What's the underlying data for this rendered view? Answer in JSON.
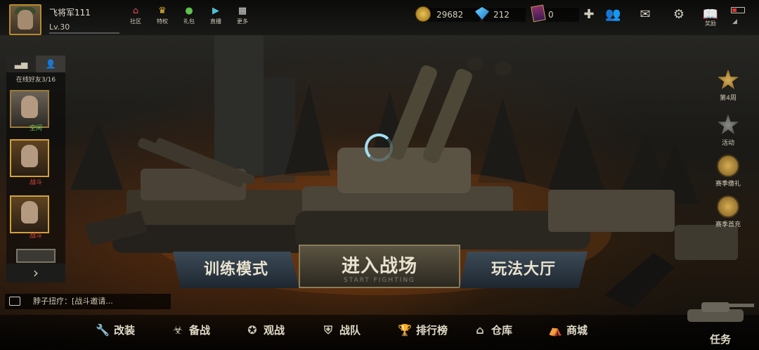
{
  "player": {
    "name": "飞将军111",
    "level": "Lv.30"
  },
  "top_nav": [
    {
      "icon": "home-icon",
      "label": "社区"
    },
    {
      "icon": "crown-icon",
      "label": "特权"
    },
    {
      "icon": "wechat-icon",
      "label": "礼包"
    },
    {
      "icon": "play-icon",
      "label": "直播"
    },
    {
      "icon": "grid-icon",
      "label": "更多"
    }
  ],
  "resources": {
    "gold": "29682",
    "diamonds": "212",
    "tickets": "0"
  },
  "top_right": {
    "reward_label": "奖励"
  },
  "friends_panel": {
    "online_text": "在线好友3/16",
    "friends": [
      {
        "tag": "空闲",
        "tag_color": "#6fd35b"
      },
      {
        "tag": "战斗",
        "tag_color": "#e0483d"
      },
      {
        "tag": "战斗",
        "tag_color": "#e0483d"
      }
    ]
  },
  "chat": {
    "message": "脖子扭疗：[战斗邀请..."
  },
  "right_events": [
    {
      "icon": "star-badge-icon",
      "label": "第4周"
    },
    {
      "icon": "star-badge-icon",
      "label": "活动"
    },
    {
      "icon": "season-badge-icon",
      "label": "赛季缴礼"
    },
    {
      "icon": "season-badge-icon",
      "label": "赛季首充"
    }
  ],
  "modes": {
    "training": "训练模式",
    "battle": "进入战场",
    "battle_sub": "START FIGHTING",
    "hall": "玩法大厅"
  },
  "bottom_menu": [
    {
      "icon": "wrench-icon",
      "label": "改装"
    },
    {
      "icon": "gasmask-icon",
      "label": "备战"
    },
    {
      "icon": "star-icon",
      "label": "观战"
    },
    {
      "icon": "shield-icon",
      "label": "战队"
    },
    {
      "icon": "trophy-icon",
      "label": "排行榜"
    },
    {
      "icon": "warehouse-icon",
      "label": "仓库"
    },
    {
      "icon": "shop-icon",
      "label": "商城"
    }
  ],
  "task_label": "任务"
}
